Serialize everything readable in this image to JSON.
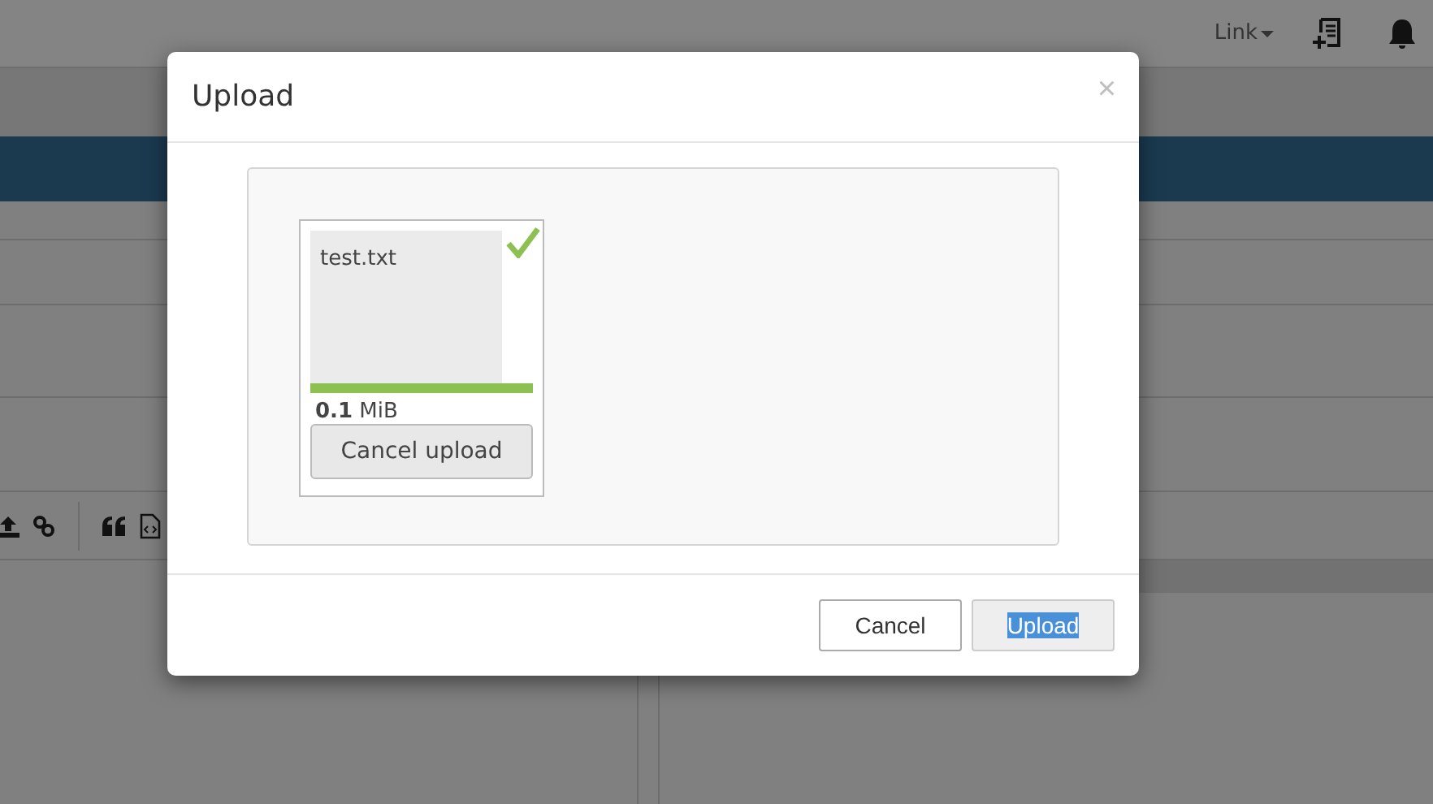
{
  "navbar": {
    "link": "Link"
  },
  "dialog": {
    "title": "Upload",
    "close": "×",
    "file": {
      "name": "test.txt",
      "complete": true,
      "level": 1,
      "size": "**0.1** MiB",
      "cancel": "Cancel upload"
    },
    "buttons": [
      {
        "label": "Cancel",
        "kind": "default",
        "text_selected": false
      },
      {
        "label": "Upload",
        "kind": "primary",
        "text_selected": true
      }
    ]
  }
}
